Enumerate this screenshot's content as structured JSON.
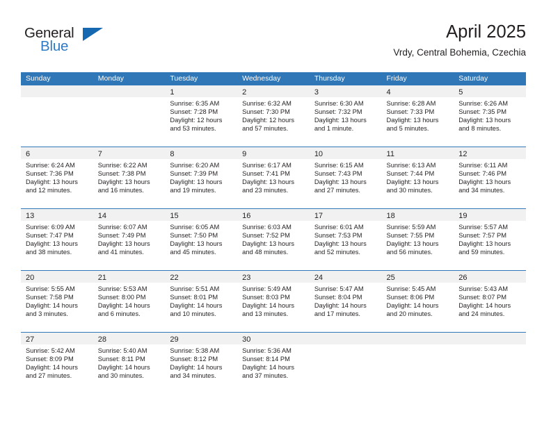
{
  "logo": {
    "word_top": "General",
    "word_bottom": "Blue",
    "triangle_color": "#1668b0",
    "blue_text_color": "#2f7ac4"
  },
  "header": {
    "month_title": "April 2025",
    "location": "Vrdy, Central Bohemia, Czechia"
  },
  "colors": {
    "header_blue": "#2f77b7",
    "date_band_gray": "#f1f1f1",
    "text": "#231f20"
  },
  "weekdays": [
    "Sunday",
    "Monday",
    "Tuesday",
    "Wednesday",
    "Thursday",
    "Friday",
    "Saturday"
  ],
  "weeks": [
    [
      {
        "day": "",
        "sunrise": "",
        "sunset": "",
        "daylight": ""
      },
      {
        "day": "",
        "sunrise": "",
        "sunset": "",
        "daylight": ""
      },
      {
        "day": "1",
        "sunrise": "Sunrise: 6:35 AM",
        "sunset": "Sunset: 7:28 PM",
        "daylight": "Daylight: 12 hours and 53 minutes."
      },
      {
        "day": "2",
        "sunrise": "Sunrise: 6:32 AM",
        "sunset": "Sunset: 7:30 PM",
        "daylight": "Daylight: 12 hours and 57 minutes."
      },
      {
        "day": "3",
        "sunrise": "Sunrise: 6:30 AM",
        "sunset": "Sunset: 7:32 PM",
        "daylight": "Daylight: 13 hours and 1 minute."
      },
      {
        "day": "4",
        "sunrise": "Sunrise: 6:28 AM",
        "sunset": "Sunset: 7:33 PM",
        "daylight": "Daylight: 13 hours and 5 minutes."
      },
      {
        "day": "5",
        "sunrise": "Sunrise: 6:26 AM",
        "sunset": "Sunset: 7:35 PM",
        "daylight": "Daylight: 13 hours and 8 minutes."
      }
    ],
    [
      {
        "day": "6",
        "sunrise": "Sunrise: 6:24 AM",
        "sunset": "Sunset: 7:36 PM",
        "daylight": "Daylight: 13 hours and 12 minutes."
      },
      {
        "day": "7",
        "sunrise": "Sunrise: 6:22 AM",
        "sunset": "Sunset: 7:38 PM",
        "daylight": "Daylight: 13 hours and 16 minutes."
      },
      {
        "day": "8",
        "sunrise": "Sunrise: 6:20 AM",
        "sunset": "Sunset: 7:39 PM",
        "daylight": "Daylight: 13 hours and 19 minutes."
      },
      {
        "day": "9",
        "sunrise": "Sunrise: 6:17 AM",
        "sunset": "Sunset: 7:41 PM",
        "daylight": "Daylight: 13 hours and 23 minutes."
      },
      {
        "day": "10",
        "sunrise": "Sunrise: 6:15 AM",
        "sunset": "Sunset: 7:43 PM",
        "daylight": "Daylight: 13 hours and 27 minutes."
      },
      {
        "day": "11",
        "sunrise": "Sunrise: 6:13 AM",
        "sunset": "Sunset: 7:44 PM",
        "daylight": "Daylight: 13 hours and 30 minutes."
      },
      {
        "day": "12",
        "sunrise": "Sunrise: 6:11 AM",
        "sunset": "Sunset: 7:46 PM",
        "daylight": "Daylight: 13 hours and 34 minutes."
      }
    ],
    [
      {
        "day": "13",
        "sunrise": "Sunrise: 6:09 AM",
        "sunset": "Sunset: 7:47 PM",
        "daylight": "Daylight: 13 hours and 38 minutes."
      },
      {
        "day": "14",
        "sunrise": "Sunrise: 6:07 AM",
        "sunset": "Sunset: 7:49 PM",
        "daylight": "Daylight: 13 hours and 41 minutes."
      },
      {
        "day": "15",
        "sunrise": "Sunrise: 6:05 AM",
        "sunset": "Sunset: 7:50 PM",
        "daylight": "Daylight: 13 hours and 45 minutes."
      },
      {
        "day": "16",
        "sunrise": "Sunrise: 6:03 AM",
        "sunset": "Sunset: 7:52 PM",
        "daylight": "Daylight: 13 hours and 48 minutes."
      },
      {
        "day": "17",
        "sunrise": "Sunrise: 6:01 AM",
        "sunset": "Sunset: 7:53 PM",
        "daylight": "Daylight: 13 hours and 52 minutes."
      },
      {
        "day": "18",
        "sunrise": "Sunrise: 5:59 AM",
        "sunset": "Sunset: 7:55 PM",
        "daylight": "Daylight: 13 hours and 56 minutes."
      },
      {
        "day": "19",
        "sunrise": "Sunrise: 5:57 AM",
        "sunset": "Sunset: 7:57 PM",
        "daylight": "Daylight: 13 hours and 59 minutes."
      }
    ],
    [
      {
        "day": "20",
        "sunrise": "Sunrise: 5:55 AM",
        "sunset": "Sunset: 7:58 PM",
        "daylight": "Daylight: 14 hours and 3 minutes."
      },
      {
        "day": "21",
        "sunrise": "Sunrise: 5:53 AM",
        "sunset": "Sunset: 8:00 PM",
        "daylight": "Daylight: 14 hours and 6 minutes."
      },
      {
        "day": "22",
        "sunrise": "Sunrise: 5:51 AM",
        "sunset": "Sunset: 8:01 PM",
        "daylight": "Daylight: 14 hours and 10 minutes."
      },
      {
        "day": "23",
        "sunrise": "Sunrise: 5:49 AM",
        "sunset": "Sunset: 8:03 PM",
        "daylight": "Daylight: 14 hours and 13 minutes."
      },
      {
        "day": "24",
        "sunrise": "Sunrise: 5:47 AM",
        "sunset": "Sunset: 8:04 PM",
        "daylight": "Daylight: 14 hours and 17 minutes."
      },
      {
        "day": "25",
        "sunrise": "Sunrise: 5:45 AM",
        "sunset": "Sunset: 8:06 PM",
        "daylight": "Daylight: 14 hours and 20 minutes."
      },
      {
        "day": "26",
        "sunrise": "Sunrise: 5:43 AM",
        "sunset": "Sunset: 8:07 PM",
        "daylight": "Daylight: 14 hours and 24 minutes."
      }
    ],
    [
      {
        "day": "27",
        "sunrise": "Sunrise: 5:42 AM",
        "sunset": "Sunset: 8:09 PM",
        "daylight": "Daylight: 14 hours and 27 minutes."
      },
      {
        "day": "28",
        "sunrise": "Sunrise: 5:40 AM",
        "sunset": "Sunset: 8:11 PM",
        "daylight": "Daylight: 14 hours and 30 minutes."
      },
      {
        "day": "29",
        "sunrise": "Sunrise: 5:38 AM",
        "sunset": "Sunset: 8:12 PM",
        "daylight": "Daylight: 14 hours and 34 minutes."
      },
      {
        "day": "30",
        "sunrise": "Sunrise: 5:36 AM",
        "sunset": "Sunset: 8:14 PM",
        "daylight": "Daylight: 14 hours and 37 minutes."
      },
      {
        "day": "",
        "sunrise": "",
        "sunset": "",
        "daylight": ""
      },
      {
        "day": "",
        "sunrise": "",
        "sunset": "",
        "daylight": ""
      },
      {
        "day": "",
        "sunrise": "",
        "sunset": "",
        "daylight": ""
      }
    ]
  ]
}
